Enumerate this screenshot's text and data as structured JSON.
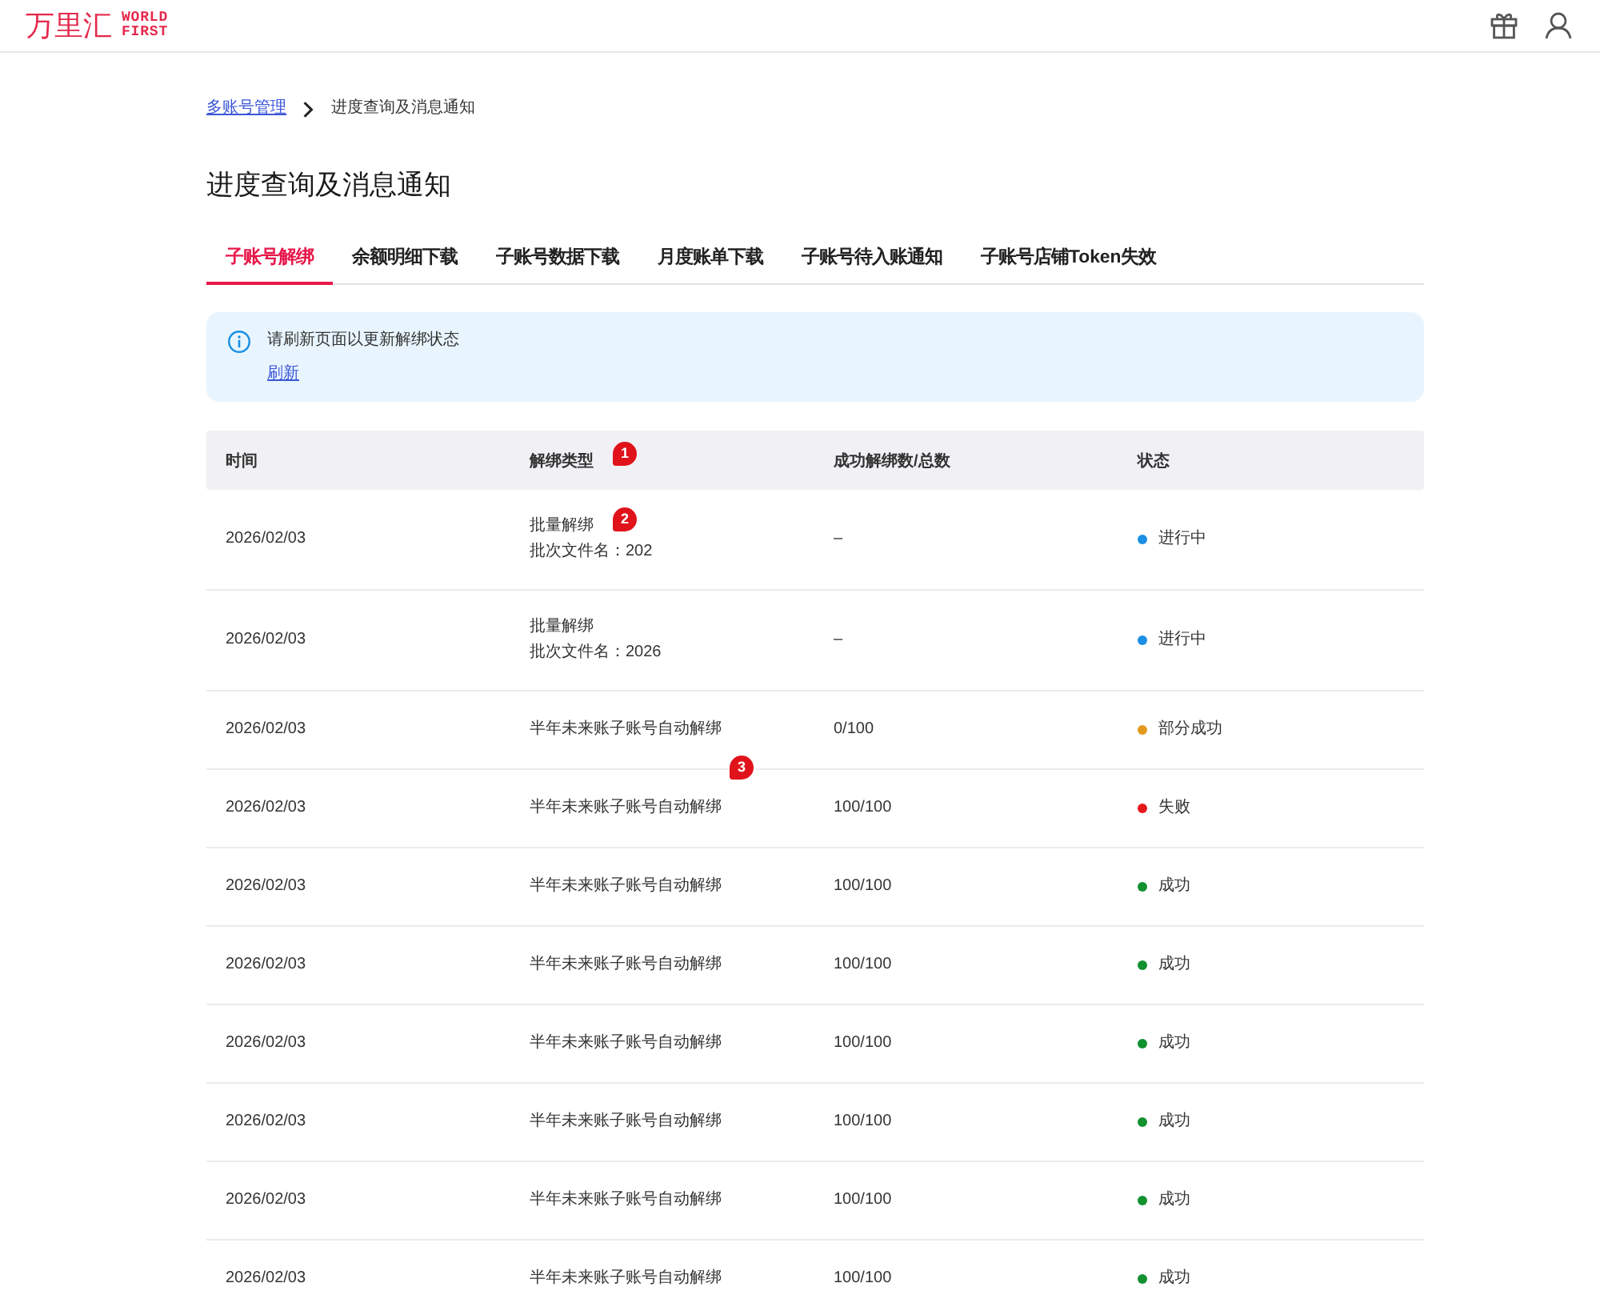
{
  "header": {
    "logo": "万里汇",
    "logo_sub": "WORLD FIRST"
  },
  "breadcrumb": {
    "parent": "多账号管理",
    "current": "进度查询及消息通知"
  },
  "title": "进度查询及消息通知",
  "tabs": [
    {
      "label": "子账号解绑",
      "selected": true
    },
    {
      "label": "余额明细下载",
      "selected": false
    },
    {
      "label": "子账号数据下载",
      "selected": false
    },
    {
      "label": "月度账单下载",
      "selected": false
    },
    {
      "label": "子账号待入账通知",
      "selected": false
    },
    {
      "label": "子账号店铺Token失效",
      "selected": false
    }
  ],
  "notice": {
    "message": "请刷新页面以更新解绑状态",
    "action": "刷新"
  },
  "table": {
    "columns": [
      {
        "label": "时间"
      },
      {
        "label": "解绑类型",
        "marker": "1"
      },
      {
        "label": "成功解绑数/总数"
      },
      {
        "label": "状态"
      }
    ],
    "rows": [
      {
        "time": "2026/02/03",
        "type": "批量解绑",
        "file": "批次文件名：202",
        "count": "–",
        "status": "进行中",
        "color": "#1a8fe3",
        "marker": "2"
      },
      {
        "time": "2026/02/03",
        "type": "批量解绑",
        "file": "批次文件名：2026",
        "count": "–",
        "status": "进行中",
        "color": "#1a8fe3"
      },
      {
        "time": "2026/02/03",
        "type": "半年未来账子账号自动解绑",
        "count": "0/100",
        "status": "部分成功",
        "color": "#e39a1c",
        "marker": "3"
      },
      {
        "time": "2026/02/03",
        "type": "半年未来账子账号自动解绑",
        "count": "100/100",
        "status": "失败",
        "color": "#e5171b"
      },
      {
        "time": "2026/02/03",
        "type": "半年未来账子账号自动解绑",
        "count": "100/100",
        "status": "成功",
        "color": "#12912f"
      },
      {
        "time": "2026/02/03",
        "type": "半年未来账子账号自动解绑",
        "count": "100/100",
        "status": "成功",
        "color": "#12912f"
      },
      {
        "time": "2026/02/03",
        "type": "半年未来账子账号自动解绑",
        "count": "100/100",
        "status": "成功",
        "color": "#12912f"
      },
      {
        "time": "2026/02/03",
        "type": "半年未来账子账号自动解绑",
        "count": "100/100",
        "status": "成功",
        "color": "#12912f"
      },
      {
        "time": "2026/02/03",
        "type": "半年未来账子账号自动解绑",
        "count": "100/100",
        "status": "成功",
        "color": "#12912f"
      },
      {
        "time": "2026/02/03",
        "type": "半年未来账子账号自动解绑",
        "count": "100/100",
        "status": "成功",
        "color": "#12912f"
      }
    ]
  }
}
